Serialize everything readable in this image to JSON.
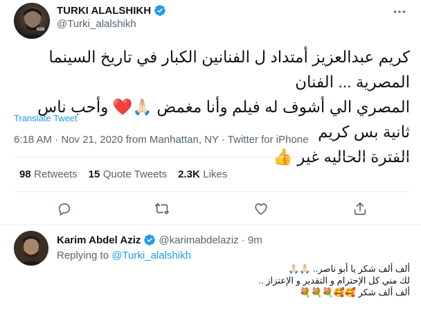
{
  "tweet": {
    "author_name": "TURKI ALALSHIKH",
    "author_handle": "@Turki_alalshikh",
    "avatar_badge": "G20",
    "text_line1": "كريم عبدالعزيز أمتداد ل الفنانين الكبار في تاريخ السينما المصرية ... الفنان",
    "text_line2": "المصري الي أشوف له فيلم وأنا مغمض 🙏🏻❤️ وأحب ناس ثانية بس كريم",
    "text_line3": "الفترة الحاليه غير 👍",
    "translate_label": "Translate Tweet",
    "timestamp": "6:18 AM · Nov 21, 2020 from Manhattan, NY · Twitter for iPhone",
    "stats": {
      "retweets_count": "98",
      "retweets_label": "Retweets",
      "quotes_count": "15",
      "quotes_label": "Quote Tweets",
      "likes_count": "2.3K",
      "likes_label": "Likes"
    }
  },
  "reply": {
    "author_name": "Karim Abdel Aziz",
    "author_handle": "@karimabdelaziz",
    "time": "· 9m",
    "replying_prefix": "Replying to",
    "replying_handle": "@Turki_alalshikh",
    "line1": "ألف ألف شكر يا أبو ناصر.. 🙏🏻🙏🏻",
    "line2": "لك مني كل الإحترام و التقدير و الإعتزاز ..",
    "line3": "ألف ألف شكر 🥰🥰💐💐💐"
  },
  "icons": {
    "more": "more-dots-icon",
    "reply": "reply-icon",
    "retweet": "retweet-icon",
    "like": "heart-icon",
    "share": "share-icon",
    "verified": "verified-badge-icon"
  },
  "colors": {
    "verified": "#1d9bf0",
    "link": "#1d9bf0",
    "secondary_text": "#536471"
  }
}
